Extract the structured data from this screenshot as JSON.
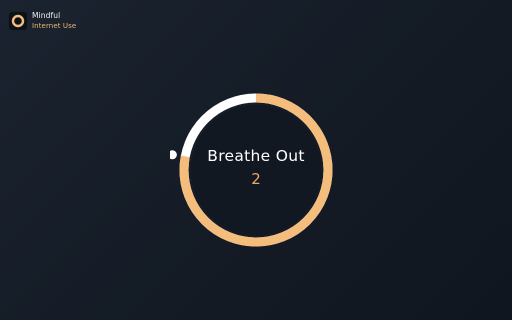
{
  "app": {
    "name": "Mindful",
    "subtitle": "Internet Use",
    "logo_icon": "ring-logo-icon"
  },
  "exercise": {
    "phase": "Breathe Out",
    "count": "2",
    "progress": 0.78
  },
  "colors": {
    "accent": "#f4bd7c",
    "accent_text": "#e9a864",
    "white": "#ffffff",
    "background": "#151c26"
  }
}
